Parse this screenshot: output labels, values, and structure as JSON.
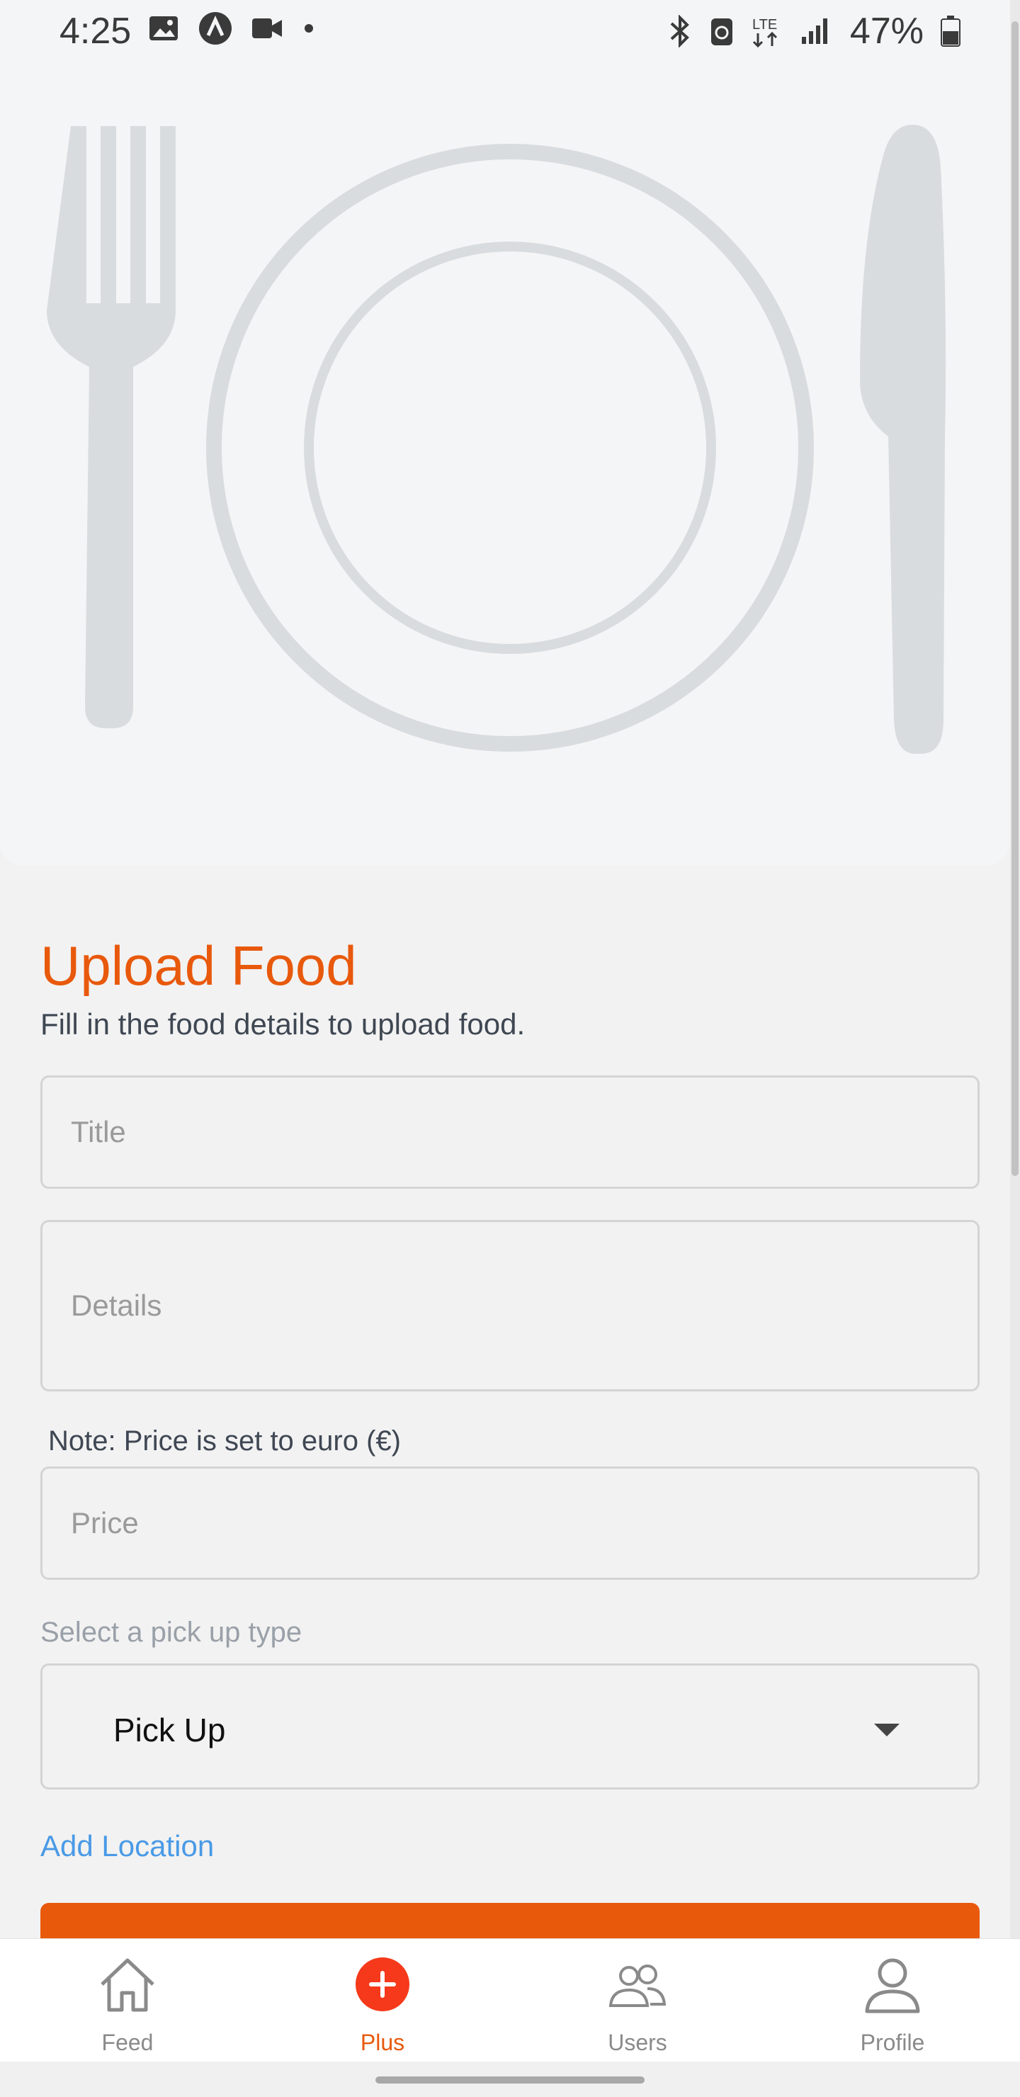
{
  "status_bar": {
    "time": "4:25",
    "battery_percent": "47%",
    "left_icons": [
      "image-icon",
      "app-icon",
      "video-icon",
      "dot-icon"
    ],
    "right_icons": [
      "bluetooth-icon",
      "nfc-icon",
      "lte-icon",
      "signal-icon",
      "battery-icon"
    ]
  },
  "form": {
    "title": "Upload Food",
    "subtitle": "Fill in the food details to upload food.",
    "title_placeholder": "Title",
    "details_placeholder": "Details",
    "price_note": "Note: Price is set to euro (€)",
    "price_placeholder": "Price",
    "pickup_label": "Select a pick up type",
    "pickup_selected": "Pick Up",
    "add_location": "Add Location"
  },
  "bottom_nav": {
    "items": [
      {
        "label": "Feed",
        "icon": "home-icon",
        "active": false
      },
      {
        "label": "Plus",
        "icon": "plus-circle-icon",
        "active": true
      },
      {
        "label": "Users",
        "icon": "users-icon",
        "active": false
      },
      {
        "label": "Profile",
        "icon": "profile-icon",
        "active": false
      }
    ]
  },
  "colors": {
    "accent": "#e8590c",
    "link": "#4a9ae6",
    "placeholder_graphic": "#d9dcde"
  }
}
